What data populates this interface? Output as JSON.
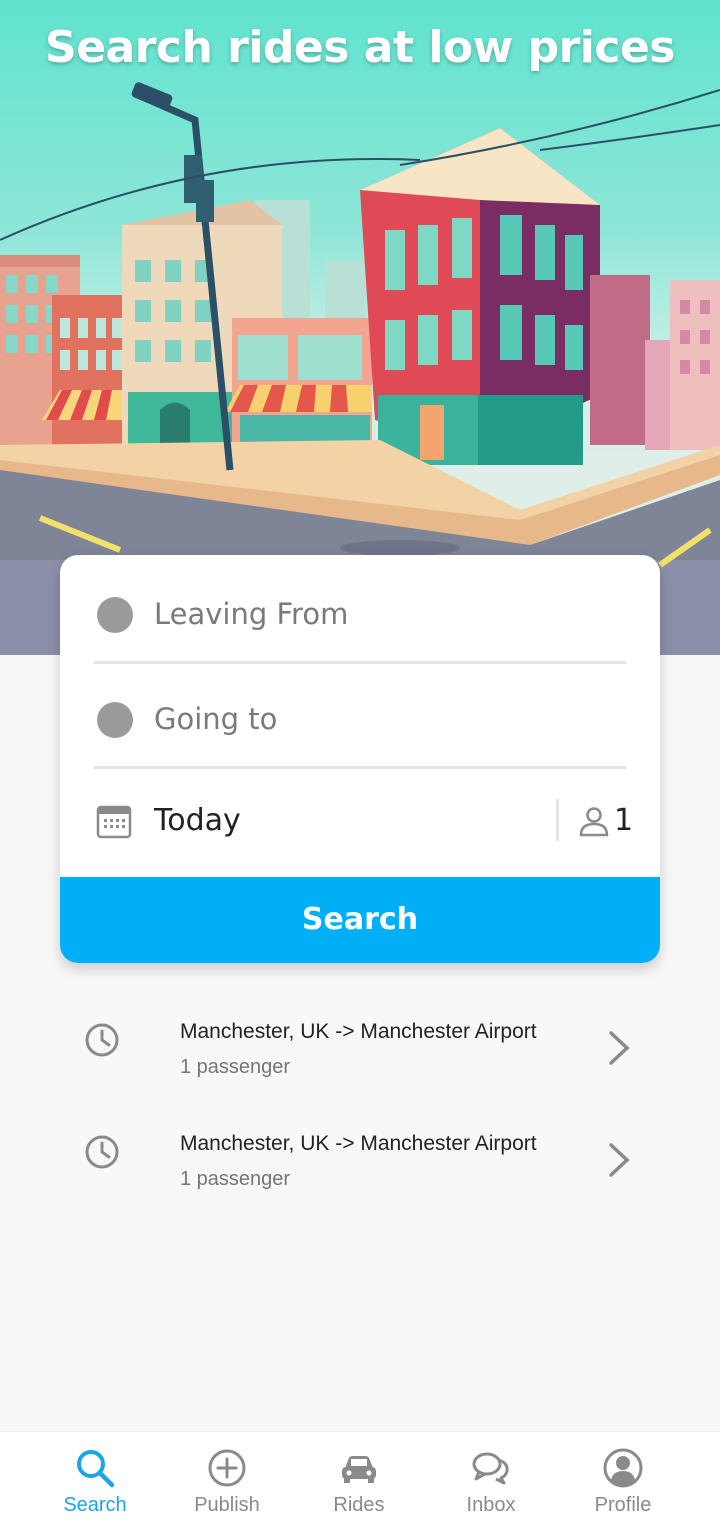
{
  "hero": {
    "title": "Search rides at low prices"
  },
  "search_card": {
    "leaving_from_placeholder": "Leaving From",
    "going_to_placeholder": "Going to",
    "date": "Today",
    "passengers": "1",
    "search_label": "Search"
  },
  "recent_searches": [
    {
      "route": "Manchester, UK -> Manchester Airport",
      "passengers": "1 passenger"
    },
    {
      "route": "Manchester, UK -> Manchester Airport",
      "passengers": "1 passenger"
    }
  ],
  "nav": {
    "items": [
      {
        "label": "Search",
        "icon": "search-icon",
        "active": true
      },
      {
        "label": "Publish",
        "icon": "plus-circle-icon",
        "active": false
      },
      {
        "label": "Rides",
        "icon": "car-icon",
        "active": false
      },
      {
        "label": "Inbox",
        "icon": "chat-icon",
        "active": false
      },
      {
        "label": "Profile",
        "icon": "profile-icon",
        "active": false
      }
    ]
  },
  "colors": {
    "accent": "#00aff5",
    "nav_active": "#1aa6e6",
    "muted": "#8a8a8a"
  }
}
